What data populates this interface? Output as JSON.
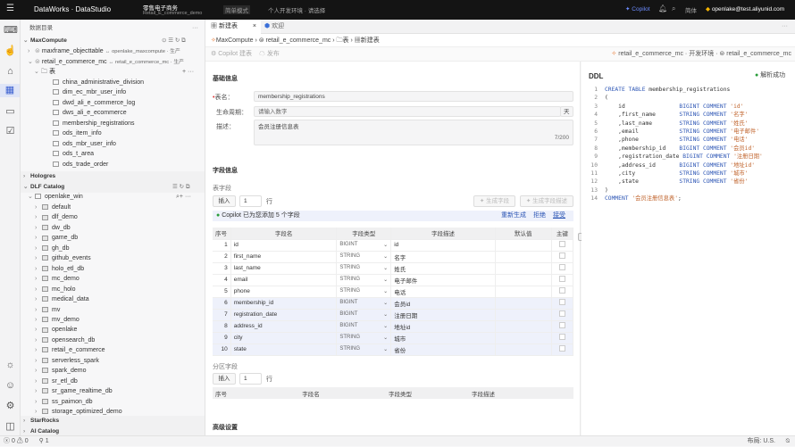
{
  "topbar": {
    "brand": "DataWorks · DataStudio",
    "project_title": "零售电子商务",
    "project_sub": "Retail_E_commerce_demo",
    "mode": "简单模式",
    "env": "个人开发环境 · 请选择",
    "copilot": "Copilot",
    "lang": "简体",
    "user": "openlake@test.aliyunid.com"
  },
  "sidebar": {
    "title": "数据目录",
    "maxcompute": "MaxCompute",
    "projects": [
      {
        "name": "maxframe_objecttable",
        "link": "↔ openlake_maxcompute · 生产"
      },
      {
        "name": "retail_e_commerce_mc",
        "link": "↔ retail_e_commerce_mc · 生产"
      }
    ],
    "folder": "表",
    "tables": [
      "china_administrative_division",
      "dim_ec_mbr_user_info",
      "dwd_ali_e_commerce_log",
      "dws_ali_e_ecommerce",
      "membership_registrations",
      "ods_item_info",
      "ods_mbr_user_info",
      "ods_t_area",
      "ods_trade_order"
    ],
    "hologres": "Hologres",
    "dlf": "DLF Catalog",
    "catalog": "openlake_win",
    "dbs": [
      "default",
      "dlf_demo",
      "dw_db",
      "game_db",
      "gh_db",
      "github_events",
      "holo_etl_db",
      "mc_demo",
      "mc_holo",
      "medical_data",
      "mv",
      "mv_demo",
      "openlake",
      "opensearch_db",
      "retail_e_commerce",
      "serverless_spark",
      "spark_demo",
      "sr_etl_db",
      "sr_game_realtime_db",
      "ss_paimon_db",
      "storage_optimized_demo"
    ],
    "starrocks": "StarRocks",
    "ai": "AI Catalog"
  },
  "tabs": [
    {
      "label": "新建表"
    },
    {
      "label": "欢迎"
    }
  ],
  "breadcrumb": [
    "MaxCompute",
    "retail_e_commerce_mc",
    "表",
    "新建表"
  ],
  "toolbar": {
    "copilot": "Copilot 建表",
    "publish": "发布",
    "env_info": "retail_e_commerce_mc · 开发环境 ·",
    "env_db": "retail_e_commerce_mc"
  },
  "basic": {
    "title": "基础信息",
    "name_label": "表名：",
    "name_value": "membership_registrations",
    "life_label": "生命周期：",
    "life_placeholder": "请输入数字",
    "life_unit": "天",
    "desc_label": "描述：",
    "desc_value": "会员注册信息表",
    "desc_count": "7/200"
  },
  "fields": {
    "title": "字段信息",
    "sub": "表字段",
    "insert": "插入",
    "count": "1",
    "row_unit": "行",
    "gen_fields": "生成字段",
    "gen_desc": "生成字段描述",
    "notice": "Copilot 已为您添加 5 个字段",
    "regen": "重新生成",
    "reject": "拒绝",
    "accept": "接受",
    "headers": [
      "序号",
      "字段名",
      "字段类型",
      "字段描述",
      "默认值",
      "主键"
    ],
    "rows": [
      [
        "1",
        "id",
        "BIGINT",
        "id"
      ],
      [
        "2",
        "first_name",
        "STRING",
        "名字"
      ],
      [
        "3",
        "last_name",
        "STRING",
        "姓氏"
      ],
      [
        "4",
        "email",
        "STRING",
        "电子邮件"
      ],
      [
        "5",
        "phone",
        "STRING",
        "电话"
      ],
      [
        "6",
        "membership_id",
        "BIGINT",
        "会员id"
      ],
      [
        "7",
        "registration_date",
        "BIGINT",
        "注册日期"
      ],
      [
        "8",
        "address_id",
        "BIGINT",
        "地址id"
      ],
      [
        "9",
        "city",
        "STRING",
        "城市"
      ],
      [
        "10",
        "state",
        "STRING",
        "省份"
      ]
    ]
  },
  "partition": {
    "sub": "分区字段",
    "insert": "插入",
    "count": "1",
    "row_unit": "行",
    "headers": [
      "序号",
      "字段名",
      "字段类型",
      "字段描述"
    ]
  },
  "advanced": {
    "title": "高级设置"
  },
  "ddl": {
    "title": "DDL",
    "status": "解析成功",
    "lines": [
      [
        {
          "t": "CREATE TABLE",
          "c": "kw"
        },
        {
          "t": " membership_registrations"
        }
      ],
      [
        {
          "t": "("
        }
      ],
      [
        {
          "t": "    id                "
        },
        {
          "t": "BIGINT COMMENT",
          "c": "kw"
        },
        {
          "t": " 'id'",
          "c": "st"
        }
      ],
      [
        {
          "t": "    ,first_name       "
        },
        {
          "t": "STRING COMMENT",
          "c": "kw"
        },
        {
          "t": " '名字'",
          "c": "st"
        }
      ],
      [
        {
          "t": "    ,last_name        "
        },
        {
          "t": "STRING COMMENT",
          "c": "kw"
        },
        {
          "t": " '姓氏'",
          "c": "st"
        }
      ],
      [
        {
          "t": "    ,email            "
        },
        {
          "t": "STRING COMMENT",
          "c": "kw"
        },
        {
          "t": " '电子邮件'",
          "c": "st"
        }
      ],
      [
        {
          "t": "    ,phone            "
        },
        {
          "t": "STRING COMMENT",
          "c": "kw"
        },
        {
          "t": " '电话'",
          "c": "st"
        }
      ],
      [
        {
          "t": "    ,membership_id    "
        },
        {
          "t": "BIGINT COMMENT",
          "c": "kw"
        },
        {
          "t": " '会员id'",
          "c": "st"
        }
      ],
      [
        {
          "t": "    ,registration_date "
        },
        {
          "t": "BIGINT COMMENT",
          "c": "kw"
        },
        {
          "t": " '注册日期'",
          "c": "st"
        }
      ],
      [
        {
          "t": "    ,address_id       "
        },
        {
          "t": "BIGINT COMMENT",
          "c": "kw"
        },
        {
          "t": " '地址id'",
          "c": "st"
        }
      ],
      [
        {
          "t": "    ,city             "
        },
        {
          "t": "STRING COMMENT",
          "c": "kw"
        },
        {
          "t": " '城市'",
          "c": "st"
        }
      ],
      [
        {
          "t": "    ,state            "
        },
        {
          "t": "STRING COMMENT",
          "c": "kw"
        },
        {
          "t": " '省份'",
          "c": "st"
        }
      ],
      [
        {
          "t": ")"
        }
      ],
      [
        {
          "t": "COMMENT",
          "c": "kw"
        },
        {
          "t": " '会员注册信息表'",
          "c": "st"
        },
        {
          "t": ";"
        }
      ]
    ]
  },
  "status": {
    "errors": "0",
    "warnings": "0",
    "ports": "1",
    "layout": "布局: U.S."
  }
}
